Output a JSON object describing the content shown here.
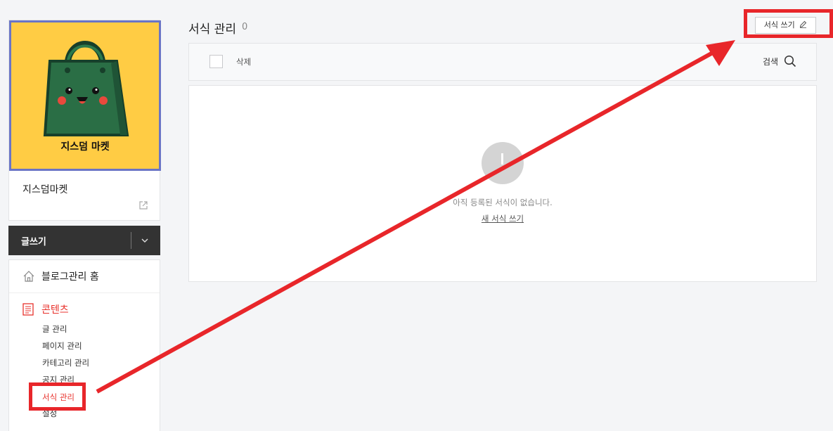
{
  "blog": {
    "logo_text": "지스덤 마켓",
    "name": "지스덤마켓"
  },
  "sidebar": {
    "write_label": "글쓰기",
    "home_label": "블로그관리 홈",
    "content_label": "콘텐츠",
    "content_items": [
      {
        "label": "글 관리"
      },
      {
        "label": "페이지 관리"
      },
      {
        "label": "카테고리 관리"
      },
      {
        "label": "공지 관리"
      },
      {
        "label": "서식 관리"
      },
      {
        "label": "설정"
      }
    ]
  },
  "main": {
    "title": "서식 관리",
    "count": "0",
    "new_button_label": "서식 쓰기",
    "toolbar": {
      "delete_label": "삭제",
      "search_label": "검색"
    },
    "empty": {
      "message": "아직 등록된 서식이 없습니다.",
      "link": "새 서식 쓰기"
    }
  },
  "colors": {
    "accent": "#e8322c",
    "annotation": "#e8262a",
    "logo_bg": "#ffcc44",
    "bag": "#1f5e3a"
  }
}
